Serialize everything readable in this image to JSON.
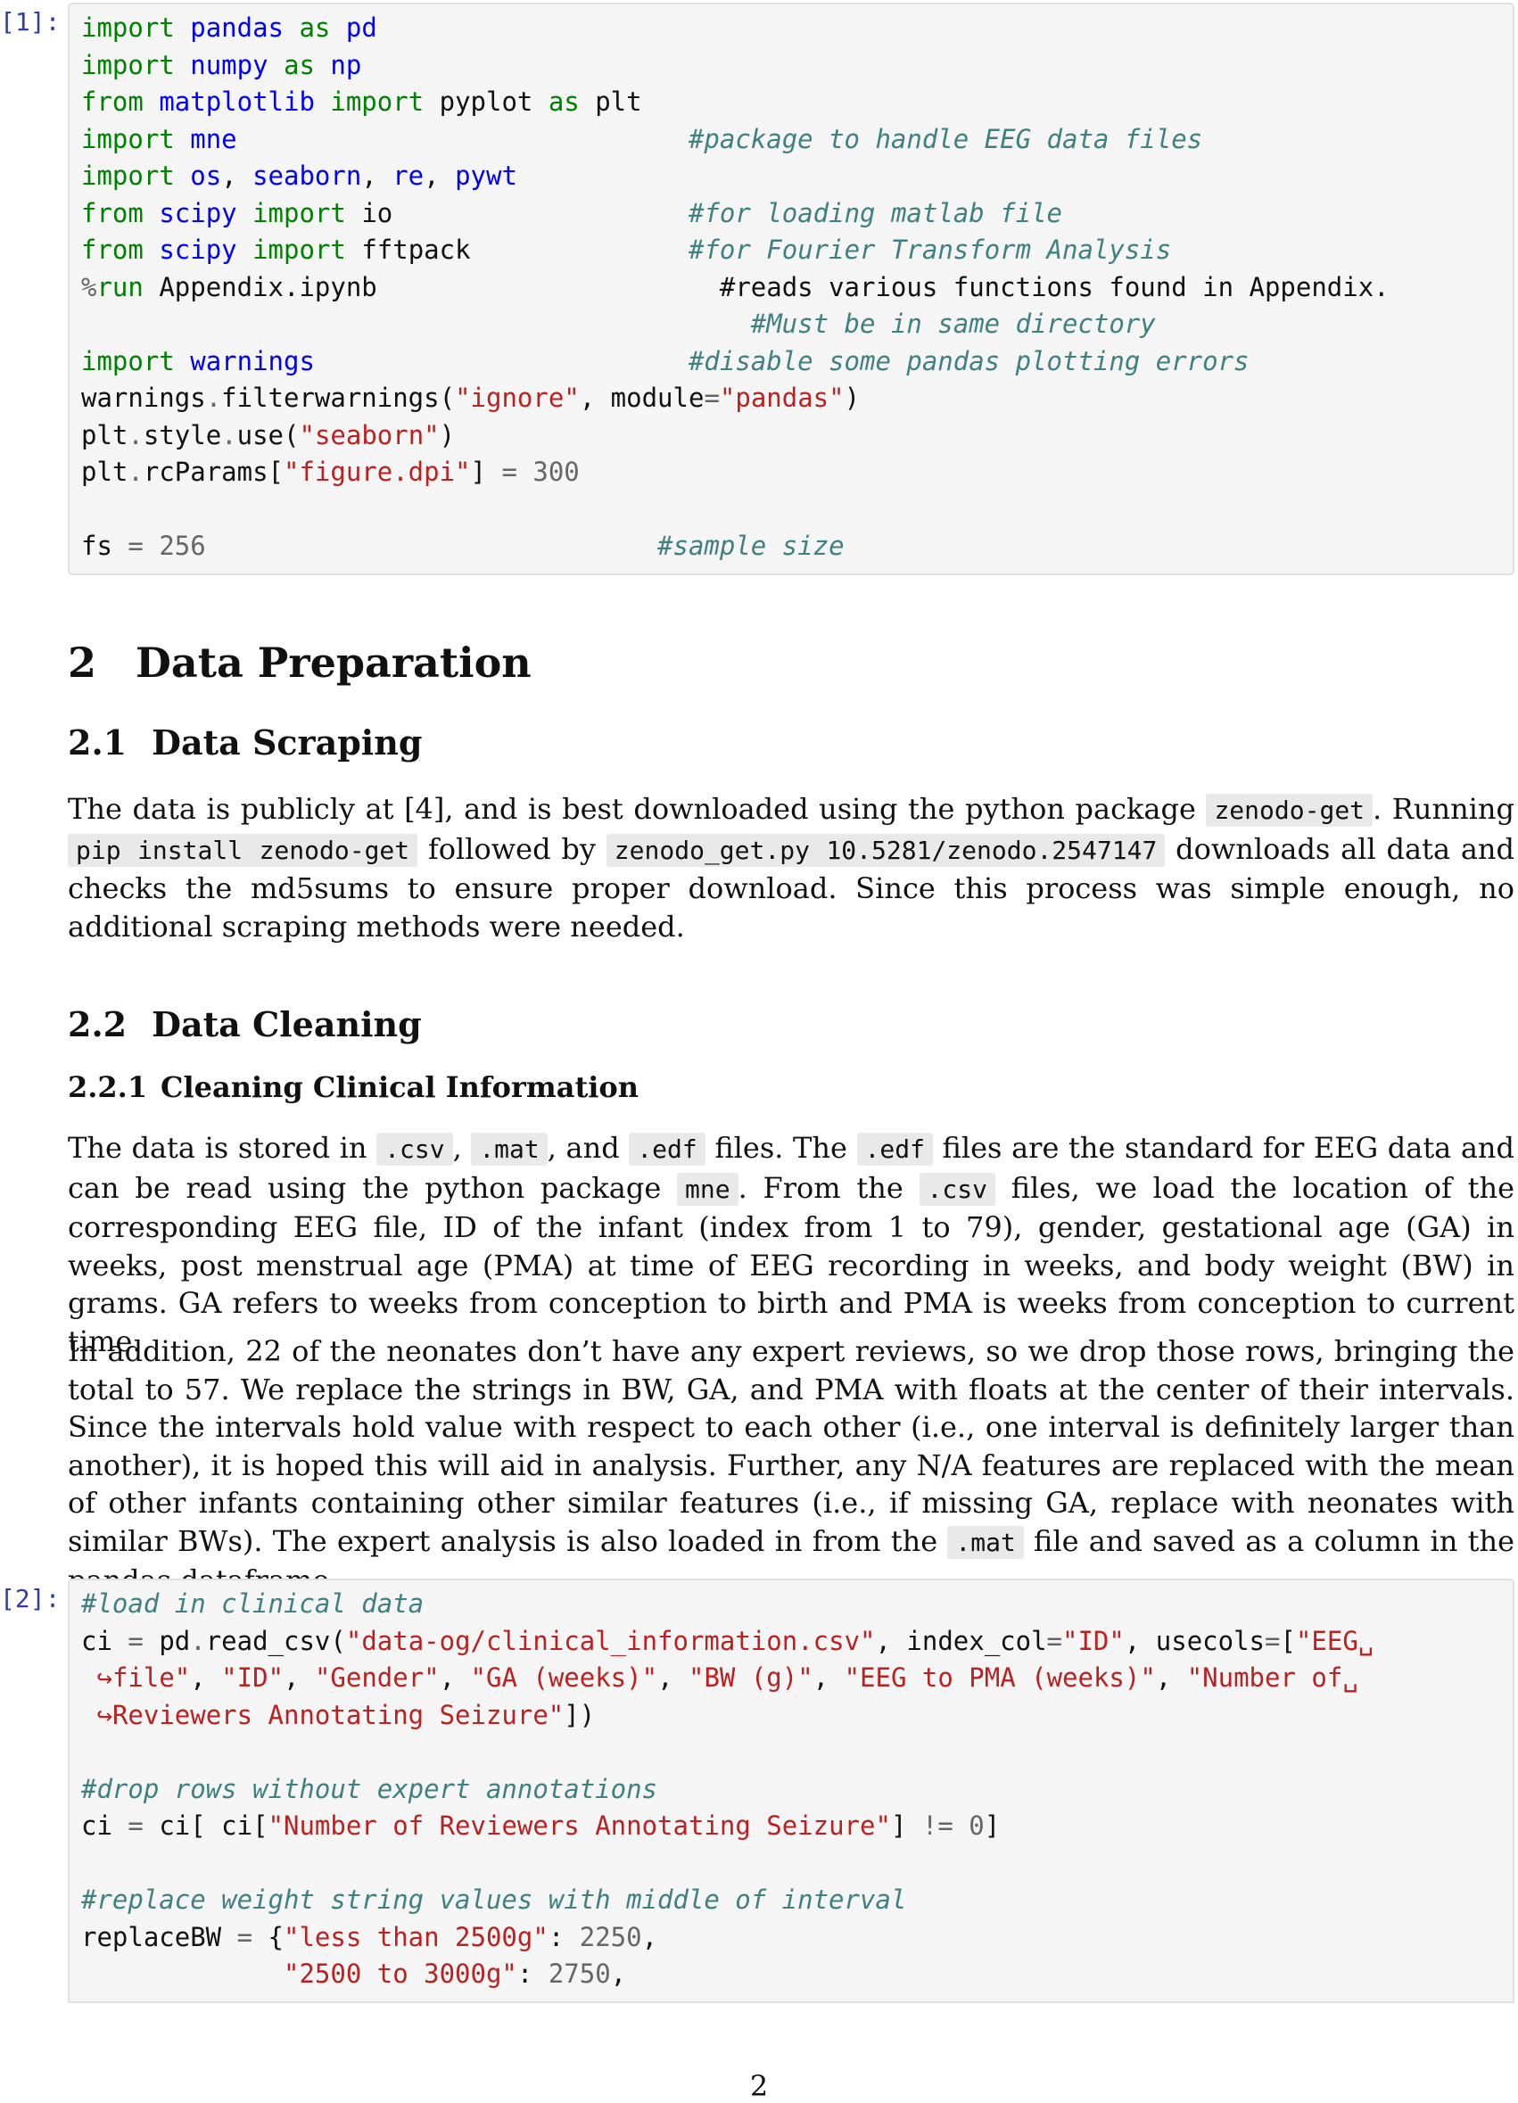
{
  "cell1": {
    "prompt": "[1]:",
    "lines": [
      {
        "a": "import",
        "b": " ",
        "c": "pandas",
        "d": " ",
        "e": "as",
        "f": " ",
        "g": "pd"
      },
      {
        "a": "import",
        "b": " ",
        "c": "numpy",
        "d": " ",
        "e": "as",
        "f": " ",
        "g": "np"
      },
      {
        "a": "from",
        "b": " ",
        "c": "matplotlib",
        "d": " ",
        "e": "import",
        "f": " pyplot ",
        "g": "as",
        "h": " plt"
      },
      {
        "a": "import",
        "b": " ",
        "c": "mne",
        "cm": "#package to handle EEG data files"
      },
      {
        "a": "import",
        "b": " ",
        "c": "os",
        "d": ", ",
        "e": "seaborn",
        "f": ", ",
        "g": "re",
        "h": ", ",
        "i": "pywt"
      },
      {
        "a": "from",
        "b": " ",
        "c": "scipy",
        "d": " ",
        "e": "import",
        "f": " io",
        "cm": "#for loading matlab file"
      },
      {
        "a": "from",
        "b": " ",
        "c": "scipy",
        "d": " ",
        "e": "import",
        "f": " fftpack",
        "cm": "#for Fourier Transform Analysis"
      },
      {
        "a": "%",
        "b": "run",
        "c": " Appendix.ipynb",
        "cm": "#reads various functions found in Appendix.",
        "cm2": "#Must be in same directory"
      },
      {
        "a": "import",
        "b": " ",
        "c": "warnings",
        "cm": "#disable some pandas plotting errors"
      },
      {
        "a": "warnings",
        "b": ".",
        "c": "filterwarnings(",
        "d": "\"ignore\"",
        "e": ", module",
        "f": "=",
        "g": "\"pandas\"",
        "h": ")"
      },
      {
        "a": "plt",
        "b": ".",
        "c": "style",
        "d": ".",
        "e": "use(",
        "f": "\"seaborn\"",
        "g": ")"
      },
      {
        "a": "plt",
        "b": ".",
        "c": "rcParams[",
        "d": "\"figure.dpi\"",
        "e": "] ",
        "f": "=",
        "g": " ",
        "h": "300"
      },
      {
        "a": "fs",
        "b": " ",
        "c": "=",
        "d": " ",
        "e": "256",
        "cm": "#sample size"
      }
    ]
  },
  "sections": {
    "s2": {
      "num": "2",
      "title": "Data Preparation"
    },
    "s21": {
      "num": "2.1",
      "title": "Data Scraping"
    },
    "s22": {
      "num": "2.2",
      "title": "Data Cleaning"
    },
    "s221": {
      "num": "2.2.1",
      "title": "Cleaning Clinical Information"
    }
  },
  "para1": {
    "t1": "The data is publicly at [4], and is best downloaded using the python package ",
    "c1": "zenodo-get",
    "t2": ". Running ",
    "c2": "pip install zenodo-get",
    "t3": " followed by ",
    "c3": "zenodo_get.py 10.5281/zenodo.2547147",
    "t4": " downloads all data and checks the md5sums to ensure proper download. Since this process was simple enough, no additional scraping methods were needed."
  },
  "para2": {
    "t1": "The data is stored in ",
    "c1": ".csv",
    "t2": ", ",
    "c2": ".mat",
    "t3": ", and ",
    "c3": ".edf",
    "t4": " files. The ",
    "c4": ".edf",
    "t5": " files are the standard for EEG data and can be read using the python package ",
    "c5": "mne",
    "t6": ". From the ",
    "c6": ".csv",
    "t7": " files, we load the location of the corresponding EEG file, ID of the infant (index from 1 to 79), gender, gestational age (GA) in weeks, post menstrual age (PMA) at time of EEG recording in weeks, and body weight (BW) in grams. GA refers to weeks from conception to birth and PMA is weeks from conception to current time."
  },
  "para3": {
    "t1": "In addition, 22 of the neonates don’t have any expert reviews, so we drop those rows, bringing the total to 57. We replace the strings in BW, GA, and PMA with floats at the center of their intervals. Since the intervals hold value with respect to each other (i.e., one interval is definitely larger than another), it is hoped this will aid in analysis. Further, any N/A features are replaced with the mean of other infants containing other similar features (i.e., if missing GA, replace with neonates with similar BWs). The expert analysis is also loaded in from the ",
    "c1": ".mat",
    "t2": " file and saved as a column in the pandas dataframe."
  },
  "cell2": {
    "prompt": "[2]:",
    "l1": "#load in clinical data",
    "l2": {
      "a": "ci ",
      "b": "=",
      "c": " pd",
      "d": ".",
      "e": "read_csv(",
      "f": "\"data-og/clinical_information.csv\"",
      "g": ", index_col",
      "h": "=",
      "i": "\"ID\"",
      "j": ", usecols",
      "k": "=",
      "l": "[",
      "m": "\"EEG",
      "n": "␣"
    },
    "l3": {
      "a": "↪",
      "b": "file\"",
      "c": ", ",
      "d": "\"ID\"",
      "e": ", ",
      "f": "\"Gender\"",
      "g": ", ",
      "h": "\"GA (weeks)\"",
      "i": ", ",
      "j": "\"BW (g)\"",
      "k": ", ",
      "l": "\"EEG to PMA (weeks)\"",
      "m": ", ",
      "n": "\"Number of",
      "o": "␣"
    },
    "l4": {
      "a": "↪",
      "b": "Reviewers Annotating Seizure\"",
      "c": "])"
    },
    "l5": "#drop rows without expert annotations",
    "l6": {
      "a": "ci ",
      "b": "=",
      "c": " ci[ ci[",
      "d": "\"Number of Reviewers Annotating Seizure\"",
      "e": "] ",
      "f": "!=",
      "g": " ",
      "h": "0",
      "i": "]"
    },
    "l7": "#replace weight string values with middle of interval",
    "l8": {
      "a": "replaceBW ",
      "b": "=",
      "c": " {",
      "d": "\"less than 2500g\"",
      "e": ": ",
      "f": "2250",
      "g": ","
    },
    "l9": {
      "a": "             ",
      "b": "\"2500 to 3000g\"",
      "c": ": ",
      "d": "2750",
      "e": ","
    }
  },
  "page_number": "2"
}
